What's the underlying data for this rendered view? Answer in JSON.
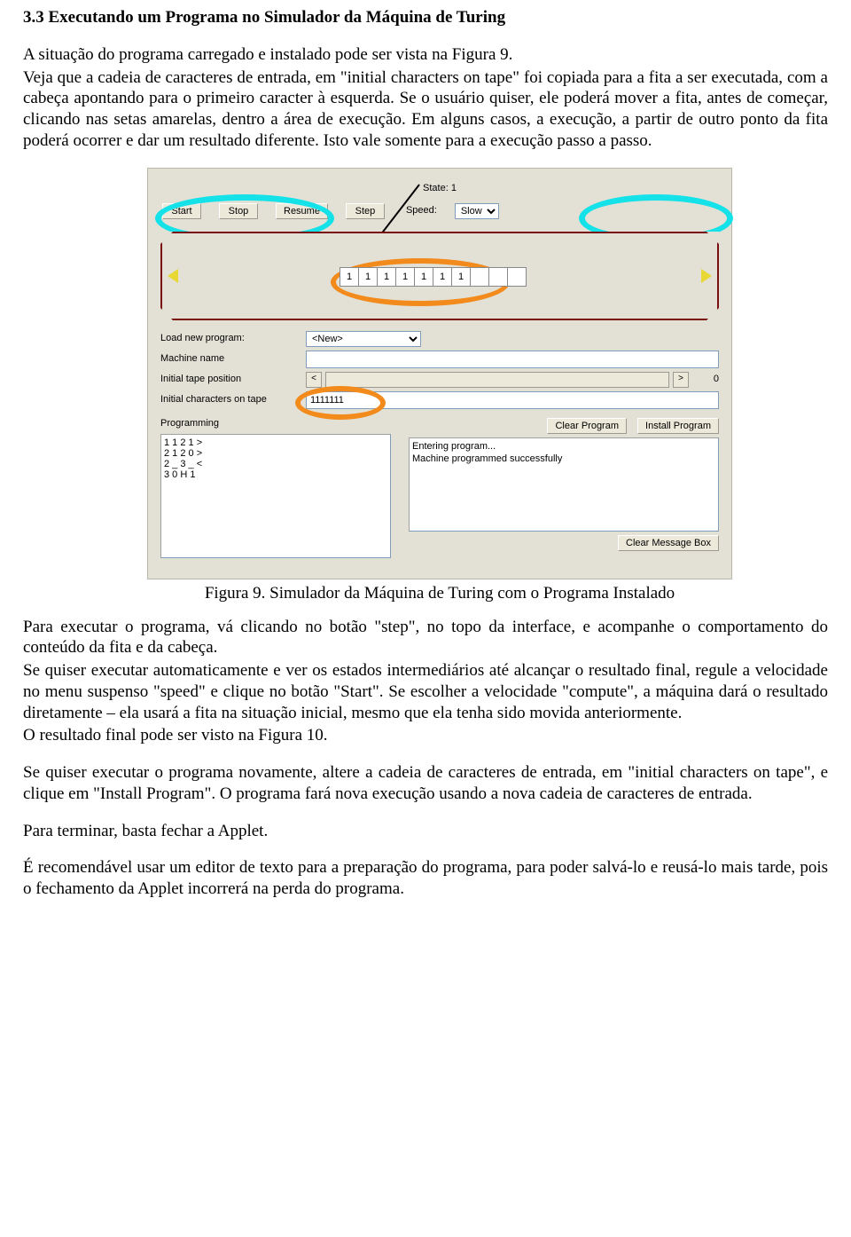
{
  "doc": {
    "section_title": "3.3 Executando um Programa no Simulador da Máquina de Turing",
    "p1": "A situação do programa carregado e instalado pode ser vista na Figura 9.",
    "p2": "Veja que a cadeia de caracteres de entrada, em \"initial characters on tape\" foi copiada para a fita a ser executada, com a cabeça apontando para o primeiro caracter à esquerda. Se o usuário quiser, ele poderá mover a fita, antes de começar, clicando nas setas amarelas, dentro a área de execução. Em alguns casos, a execução, a partir de outro ponto da fita poderá ocorrer e dar um resultado diferente. Isto vale somente para a execução passo a passo.",
    "fig_caption": "Figura 9. Simulador da Máquina de Turing com o Programa Instalado",
    "p3": "Para executar o programa, vá clicando no botão \"step\", no topo da interface, e acompanhe o comportamento do conteúdo da fita e da cabeça.",
    "p4": "Se quiser executar automaticamente e ver os estados intermediários até alcançar o resultado final, regule a velocidade no menu suspenso \"speed\" e clique no botão \"Start\". Se escolher a velocidade \"compute\", a máquina dará o resultado diretamente – ela usará a fita na situação inicial, mesmo que ela tenha sido movida anteriormente.",
    "p5": "O resultado final pode ser visto na Figura 10.",
    "p6": "Se quiser executar o programa novamente, altere a cadeia de caracteres de entrada, em \"initial characters on tape\", e clique em \"Install Program\". O programa fará nova execução usando a nova cadeia de caracteres de entrada.",
    "p7": "Para terminar, basta fechar a Applet.",
    "p8": "É recomendável usar um editor de texto para a preparação do programa, para poder salvá-lo e reusá-lo mais tarde, pois o fechamento da Applet incorrerá na perda do programa."
  },
  "applet": {
    "state_label": "State:",
    "state_value": "1",
    "buttons": {
      "start": "Start",
      "stop": "Stop",
      "resume": "Resume",
      "step": "Step"
    },
    "speed_label": "Speed:",
    "speed_value": "Slow",
    "tape_cells": [
      "1",
      "1",
      "1",
      "1",
      "1",
      "1",
      "1",
      "",
      "",
      ""
    ],
    "labels": {
      "load": "Load new program:",
      "machine": "Machine name",
      "init_pos": "Initial tape position",
      "init_chars": "Initial characters on tape",
      "programming": "Programming"
    },
    "load_value": "<New>",
    "machine_value": "",
    "init_pos_value": "0",
    "init_chars_value": "1111111",
    "right_buttons": {
      "clear_prog": "Clear Program",
      "install_prog": "Install Program",
      "clear_msg": "Clear Message Box"
    },
    "program_text": "1 1 2 1 >\n2 1 2 0 >\n2 _ 3 _ <\n3 0 H 1",
    "message_text": "Entering program...\nMachine programmed successfully"
  }
}
